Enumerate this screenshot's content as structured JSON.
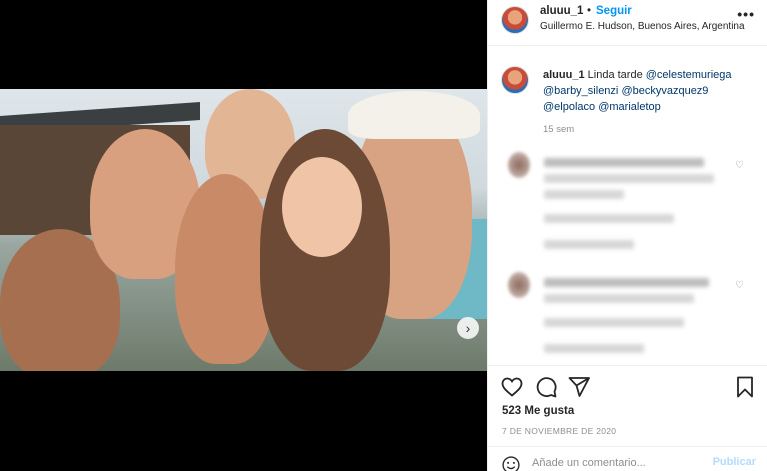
{
  "post": {
    "username": "aluuu_1",
    "separator": "•",
    "follow_label": "Seguir",
    "location": "Guillermo E. Hudson, Buenos Aires, Argentina",
    "more_icon": "more-options-icon"
  },
  "caption": {
    "username": "aluuu_1",
    "text": "Linda tarde",
    "mentions": [
      "@celestemuriega",
      "@barby_silenzi",
      "@beckyvazquez9",
      "@elpolaco",
      "@marialetop"
    ],
    "time_ago": "15 sem"
  },
  "comments": [
    {
      "blurred": true
    },
    {
      "blurred": true
    }
  ],
  "actions": {
    "icons": [
      "heart-icon",
      "comment-icon",
      "share-icon",
      "bookmark-icon"
    ],
    "likes": "523 Me gusta",
    "date": "7 DE NOVIEMBRE DE 2020"
  },
  "comment_box": {
    "emoji_icon": "emoji-icon",
    "placeholder": "Añade un comentario...",
    "publish_label": "Publicar"
  },
  "colors": {
    "accent": "#0095f6",
    "publish_disabled": "#b3dbff",
    "mention": "#00376b",
    "text": "#262626",
    "muted": "#8e8e8e"
  }
}
